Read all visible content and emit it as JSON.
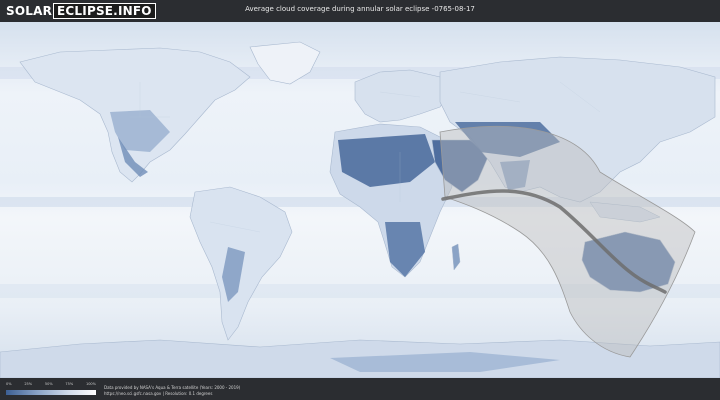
{
  "logo": {
    "part1": "SOLAR",
    "part2": "ECLIPSE.INFO"
  },
  "title": "Average cloud coverage during annular solar eclipse -0765-08-17",
  "legend": {
    "ticks": [
      "0%",
      "25%",
      "50%",
      "75%",
      "100%"
    ]
  },
  "credit": {
    "line1": "Data provided by NASA's Aqua & Terra satellite (Years: 2000 - 2019)",
    "line2": "https://neo.sci.gsfc.nasa.gov | Resolution: 0.1 degrees"
  },
  "colors": {
    "ocean": "#f1f5fa",
    "land_cloudy": "#e3eaf3",
    "land_clear": "#6f8db8",
    "land_very_clear": "#4b6a9a",
    "eclipse_band": "#b8b8b8",
    "central_line": "#6d6d6d"
  }
}
